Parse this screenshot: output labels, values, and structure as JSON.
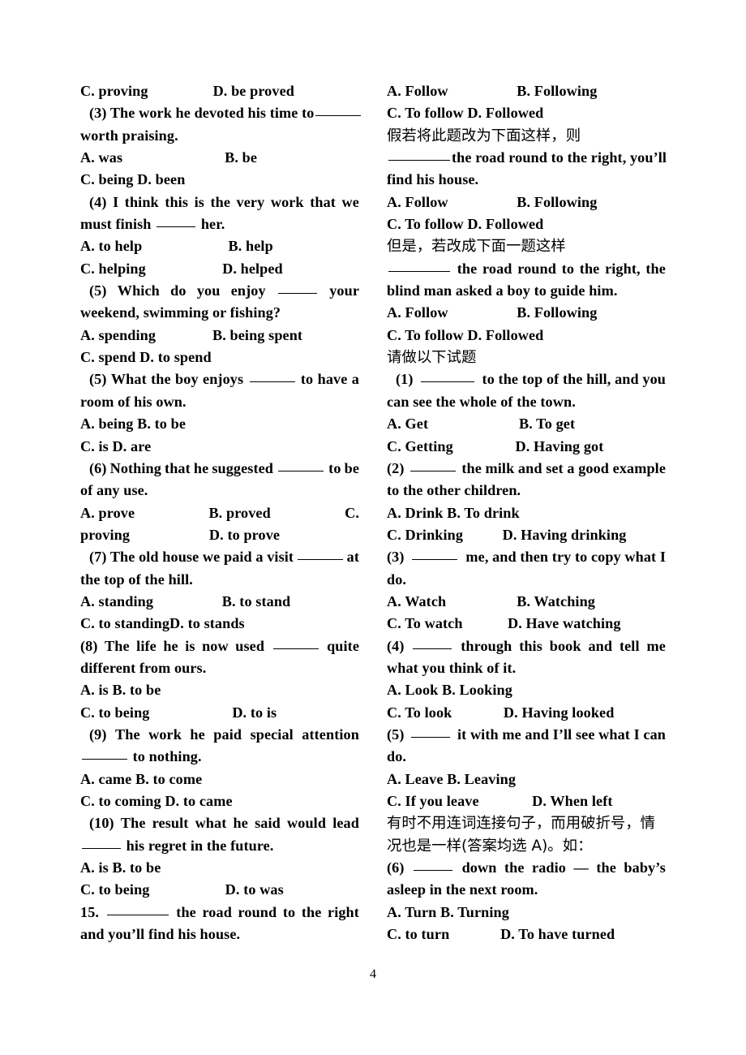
{
  "document": {
    "page_number": "4",
    "left_column": [
      {
        "type": "text",
        "segments": [
          "C. proving",
          "D. be proved",
          ""
        ],
        "justify": true
      },
      {
        "type": "text",
        "indent": 1,
        "segments": [
          "(3) The work he devoted his time to",
          "BLANK6"
        ],
        "justify": true
      },
      {
        "type": "text",
        "content": "worth praising."
      },
      {
        "type": "text",
        "segments": [
          "A. was",
          "B. be",
          ""
        ],
        "justify": true
      },
      {
        "type": "text",
        "content": "C. being D. been"
      },
      {
        "type": "text",
        "indent": 1,
        "segments": [
          "(4)",
          "I",
          "think",
          "this",
          "is",
          "the",
          "very",
          "work",
          "that",
          "we"
        ],
        "justify": true
      },
      {
        "type": "text",
        "content": "must finish BLANK5 her."
      },
      {
        "type": "text",
        "segments": [
          "A. to help",
          "B. help",
          ""
        ],
        "justify": true
      },
      {
        "type": "text",
        "segments": [
          "C. helping",
          "D. helped",
          ""
        ],
        "justify": true
      },
      {
        "type": "text",
        "indent": 1,
        "segments": [
          "(5)",
          "Which",
          "do",
          "you",
          "enjoy",
          "BLANK5",
          "your"
        ],
        "justify": true
      },
      {
        "type": "text",
        "content": "weekend, swimming or fishing?"
      },
      {
        "type": "text",
        "segments": [
          "A. spending",
          "B. being spent",
          ""
        ],
        "justify": true
      },
      {
        "type": "text",
        "content": "C. spend D. to spend"
      },
      {
        "type": "text",
        "indent": 1,
        "segments": [
          "(5)",
          "What",
          "the",
          "boy",
          "enjoys",
          "BLANK6",
          "to",
          "have",
          "a"
        ],
        "justify": true
      },
      {
        "type": "text",
        "content": "room of his own."
      },
      {
        "type": "text",
        "content": "A. being B. to be"
      },
      {
        "type": "text",
        "content": "C. is D. are"
      },
      {
        "type": "text",
        "indent": 1,
        "segments": [
          "(6)",
          "Nothing",
          "that",
          "he",
          "suggested",
          "BLANK6",
          "to",
          "be"
        ],
        "justify": true
      },
      {
        "type": "text",
        "content": "of any use."
      },
      {
        "type": "text",
        "segments": [
          "A. prove",
          "B. proved",
          "C."
        ],
        "justify": true
      },
      {
        "type": "text",
        "segments": [
          "proving",
          "D. to prove",
          ""
        ],
        "justify": true
      },
      {
        "type": "text",
        "indent": 1,
        "segments": [
          "(7) The old house we paid a visit",
          "BLANK6",
          "at"
        ],
        "justify": true
      },
      {
        "type": "text",
        "content": "the top of the hill."
      },
      {
        "type": "text",
        "segments": [
          "A. standing",
          "B. to stand",
          ""
        ],
        "justify": true
      },
      {
        "type": "text",
        "content": "C. to standingD. to stands"
      },
      {
        "type": "text",
        "segments": [
          "(8)",
          "The",
          "life",
          "he",
          "is",
          "now",
          "used",
          "BLANK6",
          "quite"
        ],
        "justify": true
      },
      {
        "type": "text",
        "content": "different from ours."
      },
      {
        "type": "text",
        "content": "A. is B. to be"
      },
      {
        "type": "text",
        "segments": [
          "C. to being",
          "D. to is",
          ""
        ],
        "justify": true
      },
      {
        "type": "text",
        "indent": 1,
        "segments": [
          "(9)",
          "The",
          "work",
          "he",
          "paid",
          "special",
          "attention"
        ],
        "justify": true
      },
      {
        "type": "text",
        "content": "BLANK6 to nothing."
      },
      {
        "type": "text",
        "content": "A. came B. to come"
      },
      {
        "type": "text",
        "content": "C. to coming D. to came"
      },
      {
        "type": "text",
        "indent": 1,
        "segments": [
          "(10)",
          "The",
          "result",
          "what",
          "he",
          "said",
          "would",
          "lead"
        ],
        "justify": true
      },
      {
        "type": "text",
        "content": "BLANK5 his regret in the future."
      },
      {
        "type": "text",
        "content": "A. is B. to be"
      },
      {
        "type": "text",
        "segments": [
          "C. to being",
          "D. to was",
          ""
        ],
        "justify": true
      },
      {
        "type": "text",
        "segments": [
          "15.",
          "BLANK8",
          "the",
          "road",
          "round",
          "to",
          "the",
          "right"
        ],
        "justify": true
      },
      {
        "type": "text",
        "content": "and you’ll find his house."
      }
    ],
    "right_column": [
      {
        "type": "text",
        "segments": [
          "A. Follow",
          "B. Following",
          ""
        ],
        "justify": true
      },
      {
        "type": "text",
        "content": "C. To follow D. Followed"
      },
      {
        "type": "cn",
        "content": "假若将此题改为下面这样，则"
      },
      {
        "type": "text",
        "segments": [
          "BLANK8",
          "the road round to the right, you’ll"
        ],
        "justify": true
      },
      {
        "type": "text",
        "content": "find his house."
      },
      {
        "type": "text",
        "segments": [
          "A. Follow",
          "B. Following",
          ""
        ],
        "justify": true
      },
      {
        "type": "text",
        "content": "C. To follow D. Followed"
      },
      {
        "type": "cn",
        "content": "但是，若改成下面一题这样"
      },
      {
        "type": "text",
        "segments": [
          "BLANK8",
          "the",
          "road",
          "round",
          "to",
          "the",
          "right,",
          "the"
        ],
        "justify": true
      },
      {
        "type": "text",
        "content": "blind man asked a boy to guide him."
      },
      {
        "type": "text",
        "segments": [
          "A. Follow",
          "B. Following",
          ""
        ],
        "justify": true
      },
      {
        "type": "text",
        "content": "C. To follow D. Followed"
      },
      {
        "type": "cn",
        "content": "请做以下试题"
      },
      {
        "type": "text",
        "indent": 1,
        "segments": [
          "(1)",
          "BLANK7",
          "to the top of the hill, and you"
        ],
        "justify": true
      },
      {
        "type": "text",
        "content": "can see the whole of the town."
      },
      {
        "type": "text",
        "segments": [
          "A. Get",
          "B. To get",
          ""
        ],
        "justify": true
      },
      {
        "type": "text",
        "segments": [
          "C. Getting",
          "D. Having got",
          ""
        ],
        "justify": true
      },
      {
        "type": "text",
        "segments": [
          "(2)",
          "BLANK6",
          "the milk and set a good example"
        ],
        "justify": true
      },
      {
        "type": "text",
        "content": "to the other children."
      },
      {
        "type": "text",
        "content": "A. Drink B. To drink"
      },
      {
        "type": "text",
        "segments": [
          "C. Drinking",
          "D. Having drinking",
          ""
        ],
        "justify": true
      },
      {
        "type": "text",
        "segments": [
          "(3)",
          "BLANK6",
          "me, and then try to copy what I"
        ],
        "justify": true
      },
      {
        "type": "text",
        "content": "do."
      },
      {
        "type": "text",
        "segments": [
          "A. Watch",
          "B. Watching",
          ""
        ],
        "justify": true
      },
      {
        "type": "text",
        "segments": [
          "C. To watch",
          "D. Have watching",
          ""
        ],
        "justify": true
      },
      {
        "type": "text",
        "segments": [
          "(4)",
          "BLANK5",
          "through",
          "this",
          "book",
          "and",
          "tell",
          "me"
        ],
        "justify": true
      },
      {
        "type": "text",
        "content": "what you think of it."
      },
      {
        "type": "text",
        "content": "A. Look B. Looking"
      },
      {
        "type": "text",
        "segments": [
          "C. To look",
          "D. Having looked",
          ""
        ],
        "justify": true
      },
      {
        "type": "text",
        "segments": [
          "(5)",
          "BLANK5",
          "it with me and I’ll see what I can"
        ],
        "justify": true
      },
      {
        "type": "text",
        "content": "do."
      },
      {
        "type": "text",
        "content": "A. Leave B. Leaving"
      },
      {
        "type": "text",
        "segments": [
          "C. If you leave",
          "D. When left",
          ""
        ],
        "justify": true
      },
      {
        "type": "cn",
        "content": "有时不用连词连接句子，而用破折号，情"
      },
      {
        "type": "cn",
        "content": "况也是一样(答案均选 A)。如："
      },
      {
        "type": "text",
        "segments": [
          "(6)",
          "BLANK5",
          "down",
          "the",
          "radio",
          "—",
          "the",
          "baby’s"
        ],
        "justify": true
      },
      {
        "type": "text",
        "content": "asleep in the next room."
      },
      {
        "type": "text",
        "content": "A. Turn B. Turning"
      },
      {
        "type": "text",
        "segments": [
          "C. to turn",
          "D. To have turned",
          ""
        ],
        "justify": true
      }
    ]
  }
}
